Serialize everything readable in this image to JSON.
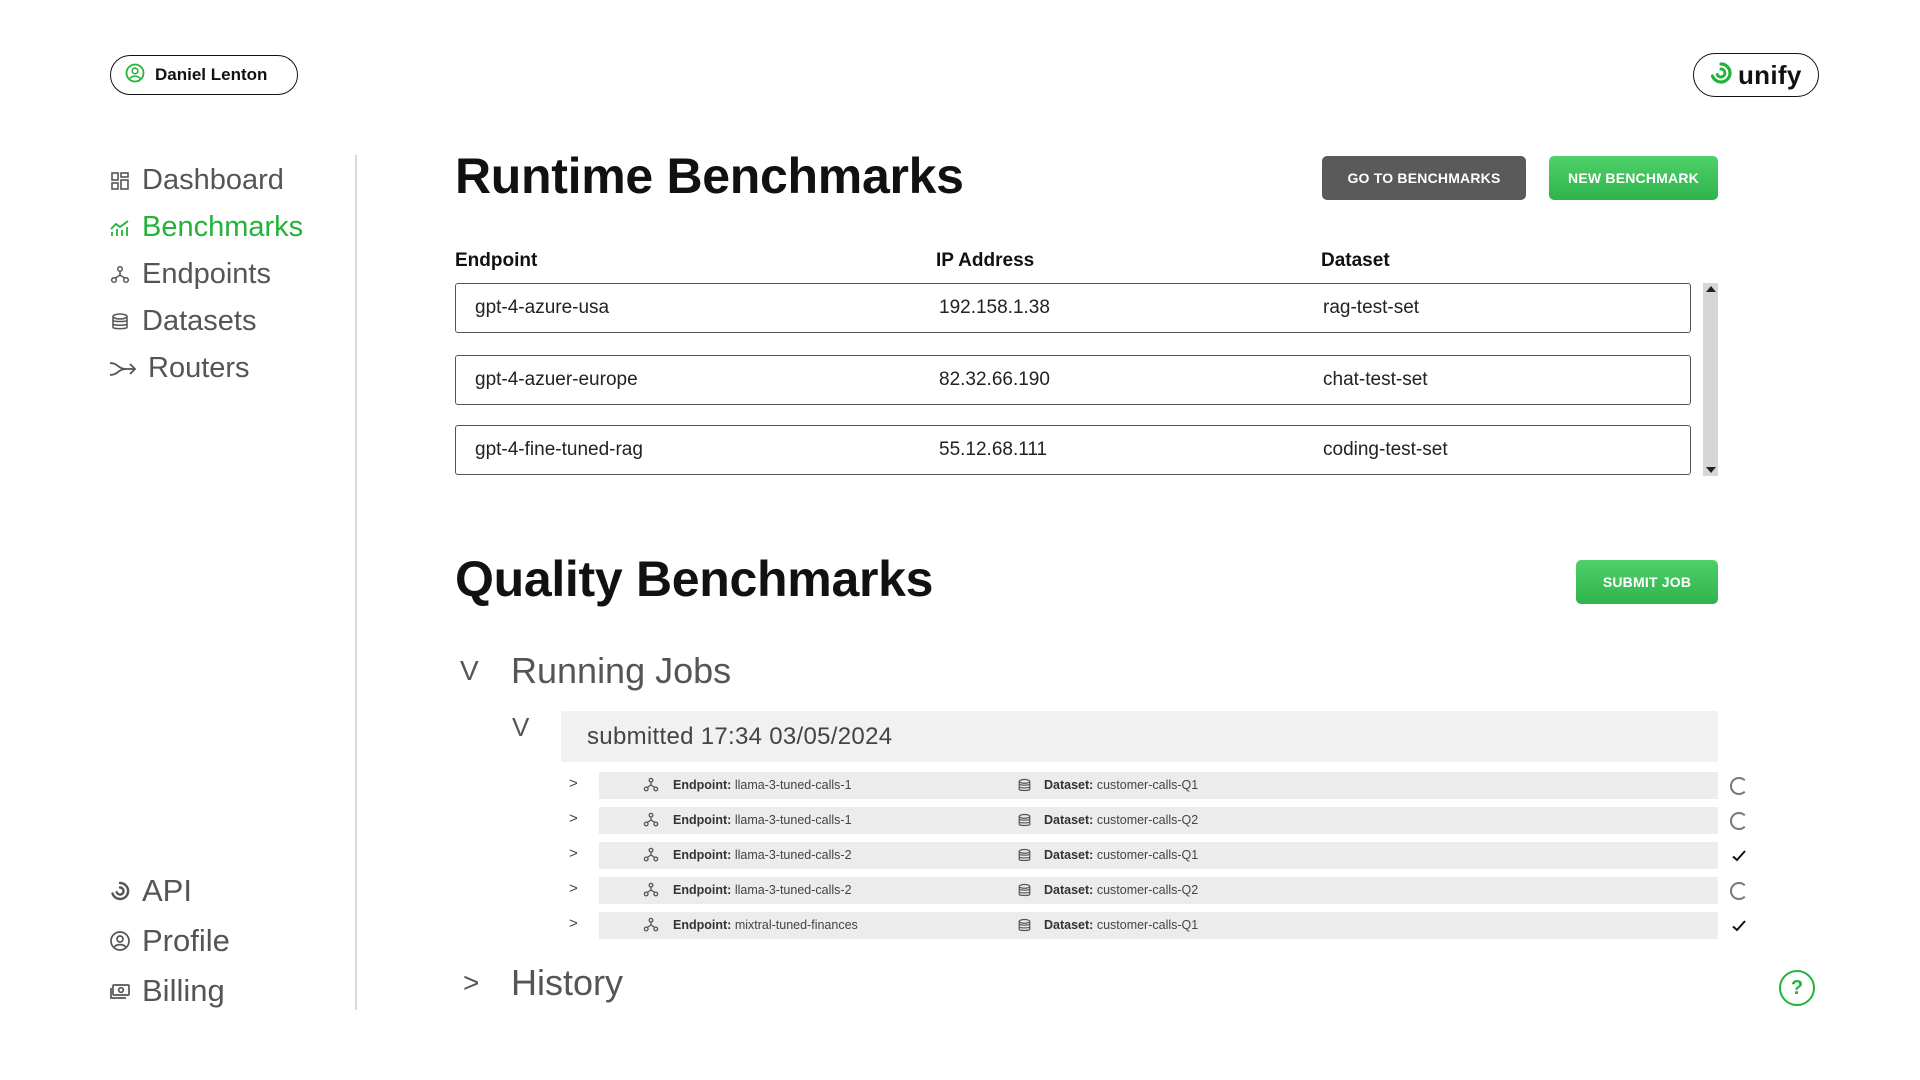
{
  "user": {
    "name": "Daniel Lenton",
    "icon": "user-circle-icon"
  },
  "brand": {
    "name": "unify",
    "accent": "#21b33a"
  },
  "sidebar": {
    "top_items": [
      {
        "label": "Dashboard",
        "icon": "dashboard-icon",
        "active": false
      },
      {
        "label": "Benchmarks",
        "icon": "chart-icon",
        "active": true
      },
      {
        "label": "Endpoints",
        "icon": "network-icon",
        "active": false
      },
      {
        "label": "Datasets",
        "icon": "database-icon",
        "active": false
      },
      {
        "label": "Routers",
        "icon": "router-icon",
        "active": false
      }
    ],
    "bottom_items": [
      {
        "label": "API",
        "icon": "api-swirl-icon"
      },
      {
        "label": "Profile",
        "icon": "profile-icon"
      },
      {
        "label": "Billing",
        "icon": "billing-icon"
      }
    ]
  },
  "runtime": {
    "title": "Runtime Benchmarks",
    "go_button": "GO TO BENCHMARKS",
    "new_button": "NEW BENCHMARK",
    "columns": [
      "Endpoint",
      "IP Address",
      "Dataset"
    ],
    "rows": [
      {
        "endpoint": "gpt-4-azure-usa",
        "ip": "192.158.1.38",
        "dataset": "rag-test-set"
      },
      {
        "endpoint": "gpt-4-azuer-europe",
        "ip": "82.32.66.190",
        "dataset": "chat-test-set"
      },
      {
        "endpoint": "gpt-4-fine-tuned-rag",
        "ip": "55.12.68.111",
        "dataset": "coding-test-set"
      }
    ]
  },
  "quality": {
    "title": "Quality Benchmarks",
    "submit_button": "SUBMIT JOB",
    "running_toggle": "V",
    "running_label": "Running Jobs",
    "group_toggle": "V",
    "group_label": "submitted 17:34 03/05/2024",
    "job_chevron": ">",
    "endpoint_key": "Endpoint:",
    "dataset_key": "Dataset:",
    "jobs": [
      {
        "endpoint": "llama-3-tuned-calls-1",
        "dataset": "customer-calls-Q1",
        "status": "running"
      },
      {
        "endpoint": "llama-3-tuned-calls-1",
        "dataset": "customer-calls-Q2",
        "status": "running"
      },
      {
        "endpoint": "llama-3-tuned-calls-2",
        "dataset": "customer-calls-Q1",
        "status": "done"
      },
      {
        "endpoint": "llama-3-tuned-calls-2",
        "dataset": "customer-calls-Q2",
        "status": "running"
      },
      {
        "endpoint": "mixtral-tuned-finances",
        "dataset": "customer-calls-Q1",
        "status": "done"
      }
    ],
    "history_toggle": ">",
    "history_label": "History"
  },
  "help": {
    "label": "?"
  }
}
